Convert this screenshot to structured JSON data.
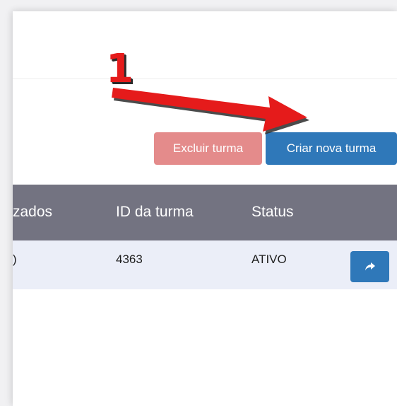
{
  "toolbar": {
    "delete_label": "Excluir turma",
    "create_label": "Criar nova turma"
  },
  "table": {
    "columns": [
      "zados",
      "ID da turma",
      "Status"
    ],
    "rows": [
      {
        "col1": ")",
        "class_id": "4363",
        "status": "ATIVO"
      }
    ]
  },
  "annotation": {
    "label": "1"
  },
  "colors": {
    "primary": "#2f78b9",
    "danger": "#e48b8b",
    "header_bg": "#737381",
    "row_bg": "#ebeef8",
    "annotation": "#e51b1b"
  },
  "icons": {
    "row_action": "share-arrow-icon"
  }
}
